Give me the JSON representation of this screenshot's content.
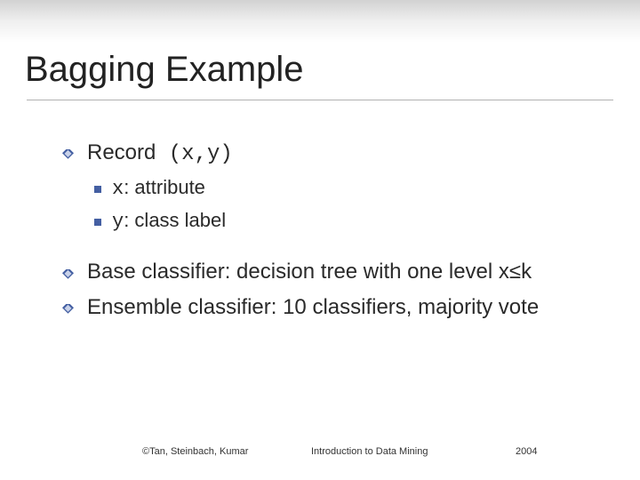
{
  "title": "Bagging Example",
  "bullets": {
    "record_label": "Record",
    "record_tuple": " (x,y)",
    "x_var": "x",
    "x_desc": ": attribute",
    "y_var": "y",
    "y_desc": ": class label",
    "base": "Base classifier: decision tree with one level x≤k",
    "ensemble": "Ensemble classifier: 10 classifiers, majority vote"
  },
  "footer": {
    "left": "©Tan, Steinbach, Kumar",
    "center": "Introduction to Data Mining",
    "right": "2004"
  }
}
